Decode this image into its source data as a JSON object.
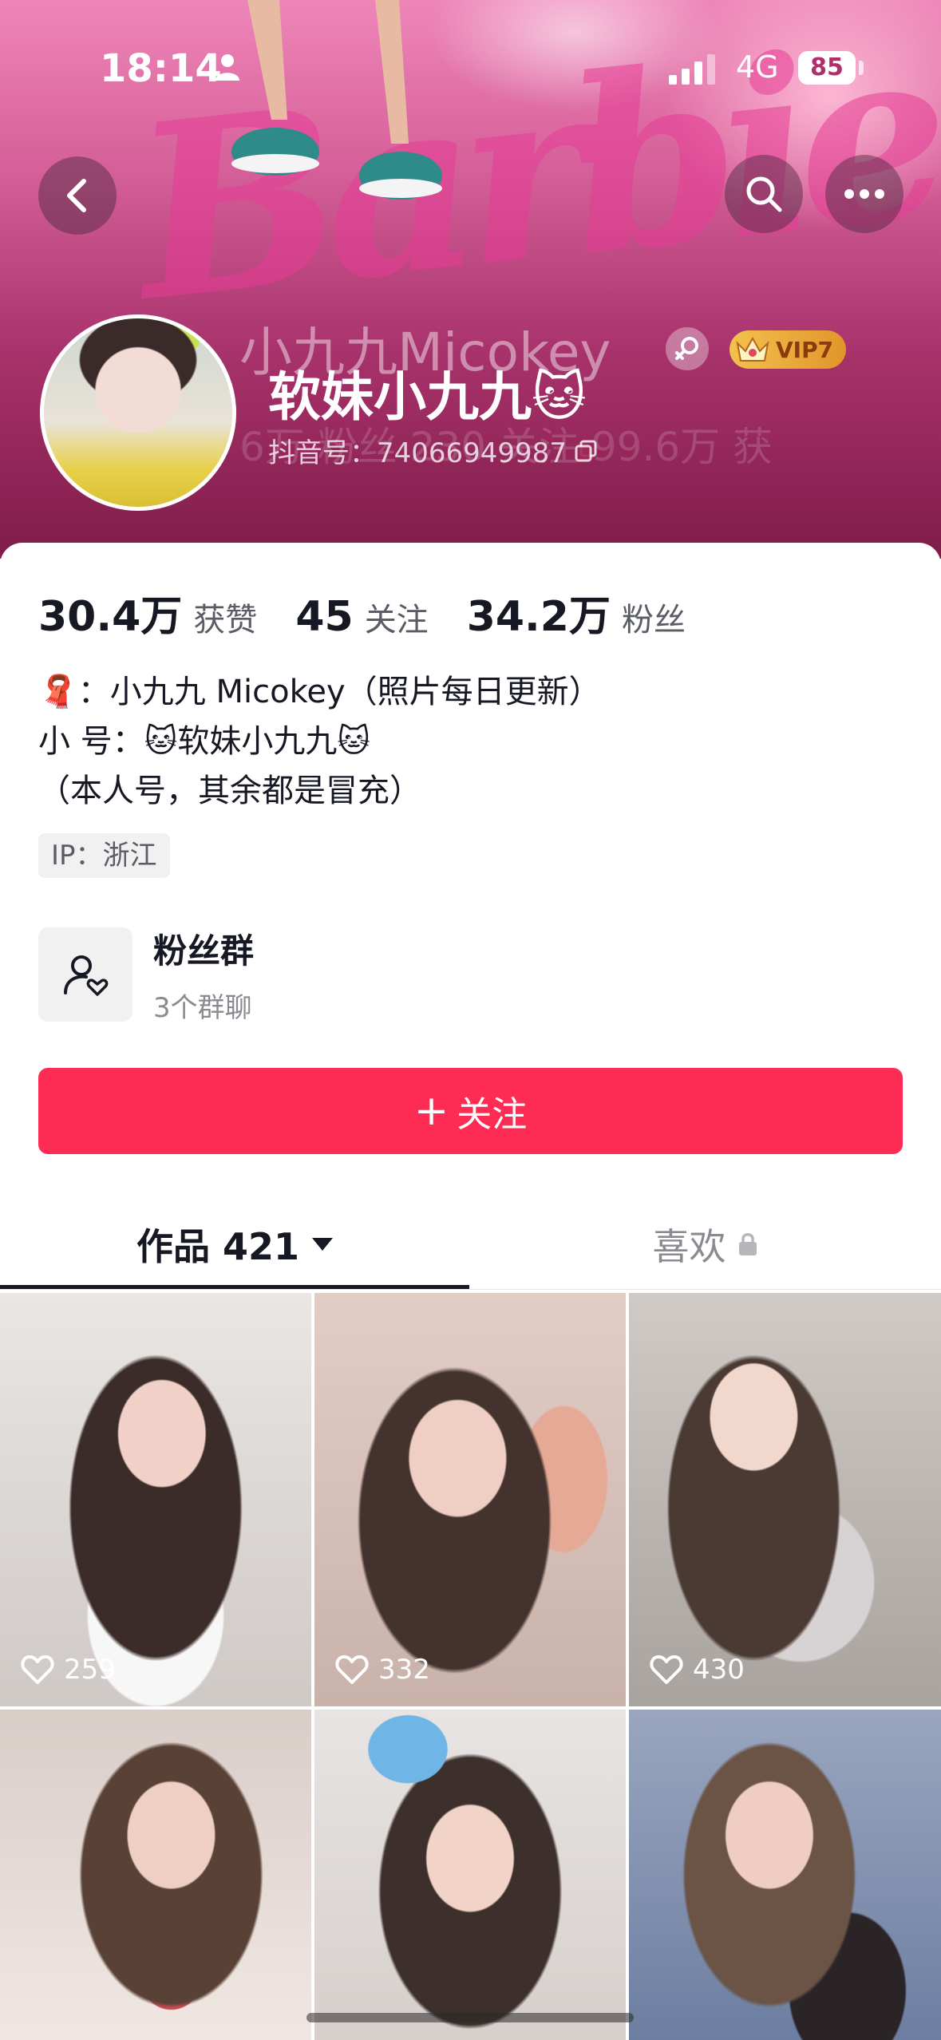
{
  "status_bar": {
    "time": "18:14",
    "network": "4G",
    "battery": "85"
  },
  "banner": {
    "ghost_name": "小九九Micokey",
    "ghost_stats": "6万 粉丝  230 关注    99.6万 获"
  },
  "profile": {
    "display_name": "软妹小九九🐱",
    "douyin_id": "抖音号：74066949987",
    "vip_label": "VIP7"
  },
  "stats": [
    {
      "value": "30.4万",
      "label": "获赞"
    },
    {
      "value": "45",
      "label": "关注"
    },
    {
      "value": "34.2万",
      "label": "粉丝"
    }
  ],
  "bio": {
    "line1": "🧣：小九九 Micokey（照片每日更新）",
    "line2": "小 号：🐱软妹小九九🐱",
    "line3": "（本人号，其余都是冒充）"
  },
  "ip_location": "IP：浙江",
  "fan_group": {
    "title": "粉丝群",
    "subtitle": "3个群聊"
  },
  "follow_button": {
    "plus": "+",
    "label": "关注"
  },
  "tabs": {
    "works_label": "作品 421",
    "likes_label": "喜欢"
  },
  "videos": [
    {
      "likes": "259"
    },
    {
      "likes": "332"
    },
    {
      "likes": "430"
    },
    {
      "likes": ""
    },
    {
      "likes": ""
    },
    {
      "likes": ""
    }
  ],
  "colors": {
    "accent": "#fe2c55",
    "text": "#161823",
    "muted": "#8a8b91"
  },
  "icons": [
    "person-icon",
    "signal-icon",
    "back-arrow-icon",
    "search-icon",
    "more-icon",
    "female-icon",
    "crown-icon",
    "copy-icon",
    "fan-group-icon",
    "dropdown-caret-icon",
    "lock-icon",
    "heart-icon"
  ]
}
